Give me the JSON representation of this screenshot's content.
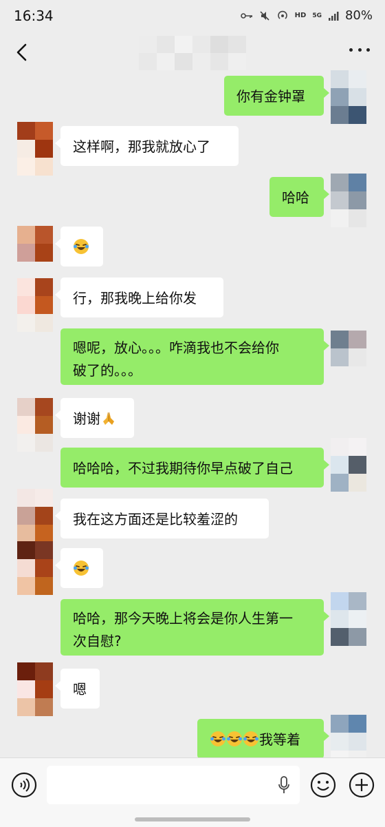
{
  "status": {
    "time": "16:34",
    "network_label": "HD",
    "signal_label": "5G",
    "battery": "80%"
  },
  "nav": {
    "back_icon": "chevron-left-icon",
    "more_icon": "more-horizontal-icon"
  },
  "messages": [
    {
      "side": "out",
      "text": "你有金钟罩"
    },
    {
      "side": "in",
      "text": "这样啊，那我就放心了"
    },
    {
      "side": "out",
      "text": "哈哈"
    },
    {
      "side": "in",
      "text": "",
      "emoji": [
        "laughing-crying-emoji"
      ]
    },
    {
      "side": "in",
      "text": "行，那我晚上给你发"
    },
    {
      "side": "out",
      "lines": [
        "嗯呢，放心。。。咋滴我也不会给你",
        "破了的。。。"
      ]
    },
    {
      "side": "in",
      "text": "谢谢",
      "emoji": [
        "folded-hands-emoji"
      ]
    },
    {
      "side": "out",
      "text": "哈哈哈，不过我期待你早点破了自己"
    },
    {
      "side": "in",
      "text": "我在这方面还是比较羞涩的"
    },
    {
      "side": "in",
      "text": "",
      "emoji": [
        "laughing-crying-emoji"
      ]
    },
    {
      "side": "out",
      "lines": [
        "哈哈，那今天晚上将会是你人生第一",
        "次自慰?"
      ]
    },
    {
      "side": "in",
      "text": "嗯"
    },
    {
      "side": "out",
      "text": "我等着",
      "emoji": [
        "laughing-crying-emoji",
        "laughing-crying-emoji",
        "laughing-crying-emoji"
      ]
    }
  ],
  "input": {
    "placeholder": "",
    "voice_icon": "voice-icon",
    "mic_icon": "microphone-icon",
    "emoji_icon": "smiley-icon",
    "plus_icon": "plus-circle-icon"
  },
  "colors": {
    "background": "#ededed",
    "outgoing_bubble": "#95ec69",
    "incoming_bubble": "#ffffff"
  }
}
